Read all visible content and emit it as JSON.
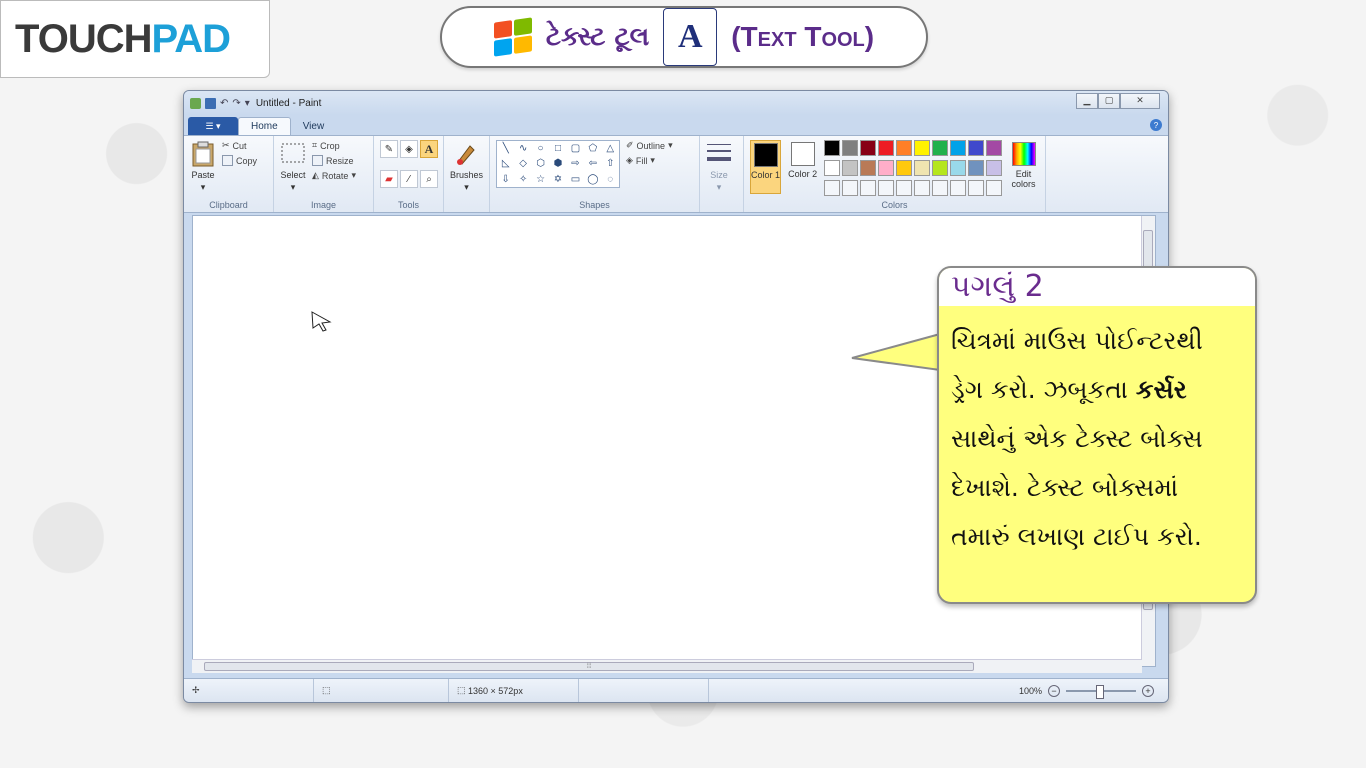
{
  "logo": {
    "part1": "TOUCH",
    "part2": "PAD"
  },
  "title": {
    "gujarati": "ટેક્સ્ટ ટૂલ",
    "icon_letter": "A",
    "english": "(Text Tool)"
  },
  "paint": {
    "window_title": "Untitled - Paint",
    "tabs": [
      "Home",
      "View"
    ],
    "clipboard": {
      "paste": "Paste",
      "cut": "Cut",
      "copy": "Copy",
      "label": "Clipboard"
    },
    "image": {
      "select": "Select",
      "crop": "Crop",
      "resize": "Resize",
      "rotate": "Rotate",
      "label": "Image"
    },
    "tools": {
      "label": "Tools",
      "text_icon": "A"
    },
    "brushes": {
      "label": "Brushes"
    },
    "shapes": {
      "label": "Shapes",
      "outline": "Outline",
      "fill": "Fill"
    },
    "size": {
      "label": "Size"
    },
    "colors": {
      "color1_label": "Color 1",
      "color2_label": "Color 2",
      "edit_label": "Edit colors",
      "label": "Colors",
      "color1": "#000000",
      "color2": "#ffffff",
      "palette": [
        "#000000",
        "#7f7f7f",
        "#880015",
        "#ed1c24",
        "#ff7f27",
        "#fff200",
        "#22b14c",
        "#00a2e8",
        "#3f48cc",
        "#a349a4",
        "#ffffff",
        "#c3c3c3",
        "#b97a57",
        "#ffaec9",
        "#ffc90e",
        "#efe4b0",
        "#b5e61d",
        "#99d9ea",
        "#7092be",
        "#c8bfe7",
        "#ffffff",
        "#ffffff",
        "#ffffff",
        "#ffffff",
        "#ffffff",
        "#ffffff",
        "#ffffff",
        "#ffffff",
        "#ffffff",
        "#ffffff"
      ]
    },
    "status": {
      "dimensions": "1360 × 572px",
      "zoom": "100%"
    }
  },
  "callout": {
    "heading": "પગલું 2",
    "line1": "ચિત્રમાં માઉસ પોઈન્ટરથી",
    "line2a": "ડ્રેગ કરો. ઝબૂકતા ",
    "line2b": "કર્સર",
    "line3": "સાથેનું એક ટેક્સ્ટ બોક્સ",
    "line4": "દેખાશે. ટેક્સ્ટ બોક્સમાં",
    "line5": "તમારું લખાણ ટાઈપ કરો."
  }
}
